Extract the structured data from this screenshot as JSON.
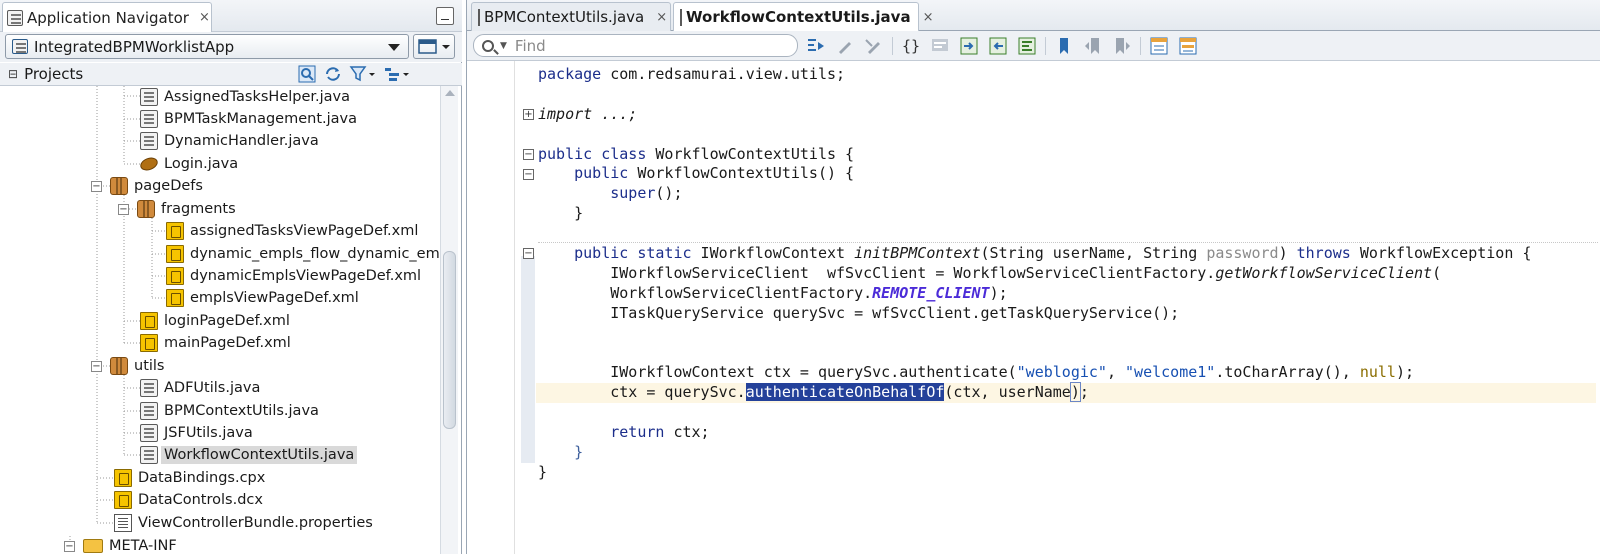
{
  "navigator": {
    "title": "Application Navigator",
    "close_glyph": "×",
    "application": "IntegratedBPMWorklistApp",
    "projects_label": "Projects",
    "tree": [
      {
        "label": "AssignedTasksHelper.java",
        "icon": "java-file-icon"
      },
      {
        "label": "BPMTaskManagement.java",
        "icon": "java-file-icon"
      },
      {
        "label": "DynamicHandler.java",
        "icon": "java-file-icon"
      },
      {
        "label": "Login.java",
        "icon": "bean-icon"
      },
      {
        "label": "pageDefs",
        "icon": "package-icon"
      },
      {
        "label": "fragments",
        "icon": "package-icon"
      },
      {
        "label": "assignedTasksViewPageDef.xml",
        "icon": "xml-file-icon"
      },
      {
        "label": "dynamic_empls_flow_dynamic_em",
        "icon": "xml-file-icon"
      },
      {
        "label": "dynamicEmplsViewPageDef.xml",
        "icon": "xml-file-icon"
      },
      {
        "label": "emplsViewPageDef.xml",
        "icon": "xml-file-icon"
      },
      {
        "label": "loginPageDef.xml",
        "icon": "xml-file-icon"
      },
      {
        "label": "mainPageDef.xml",
        "icon": "xml-file-icon"
      },
      {
        "label": "utils",
        "icon": "package-icon"
      },
      {
        "label": "ADFUtils.java",
        "icon": "java-file-icon"
      },
      {
        "label": "BPMContextUtils.java",
        "icon": "java-file-icon"
      },
      {
        "label": "JSFUtils.java",
        "icon": "java-file-icon"
      },
      {
        "label": "WorkflowContextUtils.java",
        "icon": "java-file-icon"
      },
      {
        "label": "DataBindings.cpx",
        "icon": "xml-file-icon"
      },
      {
        "label": "DataControls.dcx",
        "icon": "xml-file-icon"
      },
      {
        "label": "ViewControllerBundle.properties",
        "icon": "properties-file-icon"
      },
      {
        "label": "META-INF",
        "icon": "folder-icon"
      }
    ]
  },
  "editor": {
    "tabs": [
      {
        "label": "BPMContextUtils.java",
        "close": "×"
      },
      {
        "label": "WorkflowContextUtils.java",
        "close": "×"
      }
    ],
    "find_placeholder": "Find",
    "code": {
      "l1_kw": "package",
      "l1_rest": " com.redsamurai.view.utils;",
      "l3": "import ...;",
      "l5_kw": "public class",
      "l5_rest": " WorkflowContextUtils {",
      "l6_kw": "public",
      "l6_rest": " WorkflowContextUtils() {",
      "l7_kw": "super",
      "l7_rest": "();",
      "l8": "}",
      "l10_kw1": "public static",
      "l10_a": " IWorkflowContext ",
      "l10_method": "initBPMContext",
      "l10_b": "(String userName, String ",
      "l10_unused": "password",
      "l10_c": ") ",
      "l10_kw2": "throws",
      "l10_d": " WorkflowException {",
      "l11_a": "IWorkflowServiceClient  wfSvcClient = WorkflowServiceClientFactory.",
      "l11_method": "getWorkflowServiceClient",
      "l11_b": "(",
      "l12_a": "WorkflowServiceClientFactory.",
      "l12_field": "REMOTE_CLIENT",
      "l12_b": ");",
      "l13": "ITaskQueryService querySvc = wfSvcClient.getTaskQueryService();",
      "l16_a": "IWorkflowContext ctx = querySvc.authenticate(",
      "l16_s1": "\"weblogic\"",
      "l16_b": ", ",
      "l16_s2": "\"welcome1\"",
      "l16_c": ".toCharArray(), ",
      "l16_null": "null",
      "l16_d": ");",
      "l17_a": "ctx = querySvc.",
      "l17_sel": "authenticateOnBehalfOf",
      "l17_b": "(ctx, userName",
      "l17_c": ")",
      "l17_d": ";",
      "l19_kw": "return",
      "l19_rest": " ctx;",
      "l20": "}",
      "l21": "}"
    }
  }
}
